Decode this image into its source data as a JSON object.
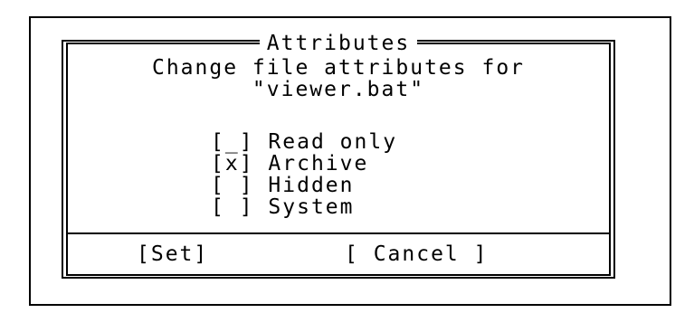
{
  "dialog": {
    "title": "Attributes",
    "message_line1": "Change file attributes for",
    "message_line2": "\"viewer.bat\""
  },
  "attributes": [
    {
      "mark": "_",
      "label": "Read only",
      "checked": false
    },
    {
      "mark": "x",
      "label": "Archive",
      "checked": true
    },
    {
      "mark": " ",
      "label": "Hidden",
      "checked": false
    },
    {
      "mark": " ",
      "label": "System",
      "checked": false
    }
  ],
  "buttons": {
    "set": "[Set]",
    "cancel": "[ Cancel ]"
  }
}
